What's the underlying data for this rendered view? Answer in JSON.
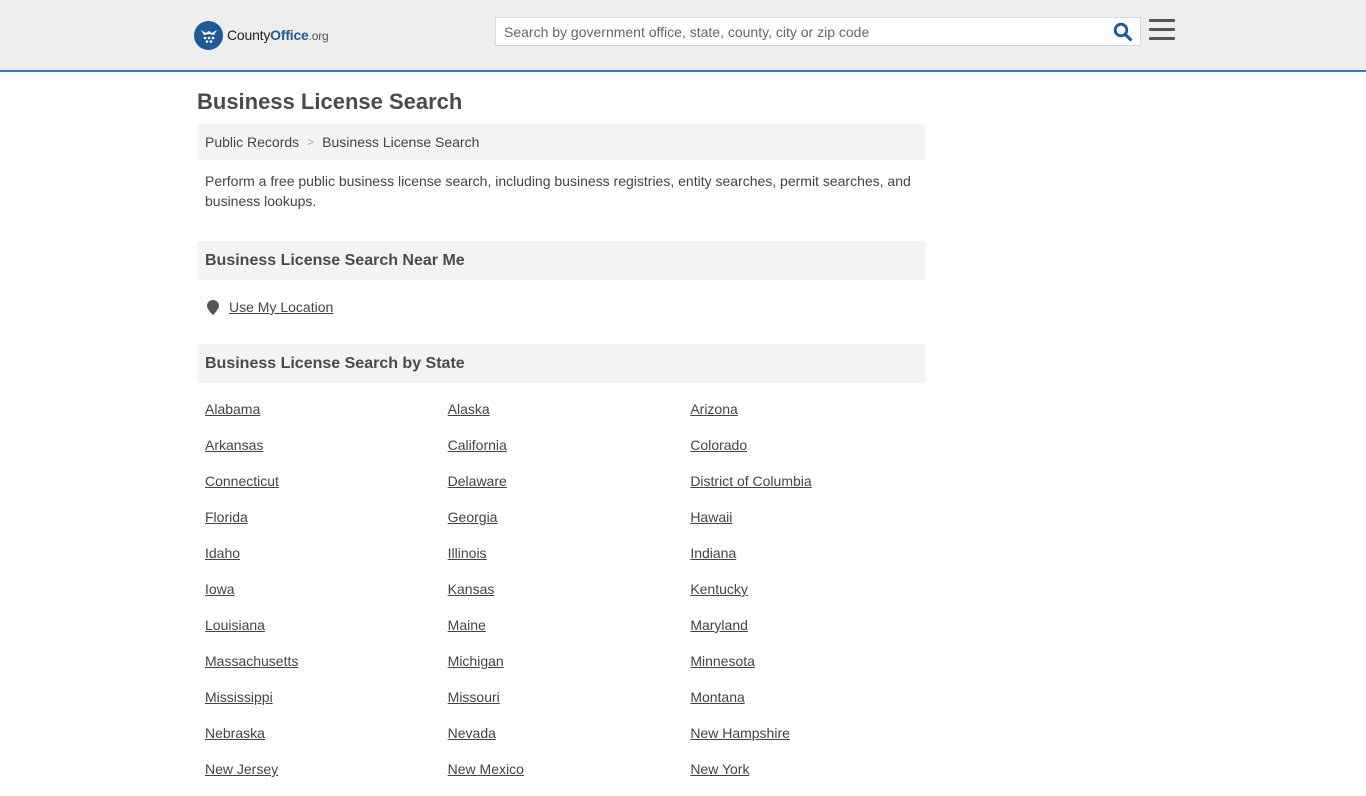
{
  "header": {
    "logo": {
      "name_main": "County",
      "name_accent": "Office",
      "name_suffix": ".org",
      "colors": {
        "brand": "#1f5a96"
      }
    },
    "search": {
      "placeholder": "Search by government office, state, county, city or zip code",
      "value": ""
    },
    "icons": {
      "search": "search-icon",
      "menu": "hamburger-menu-icon"
    }
  },
  "page": {
    "title": "Business License Search",
    "breadcrumb": [
      {
        "label": "Public Records"
      },
      {
        "label": "Business License Search"
      }
    ],
    "breadcrumb_separator": ">",
    "intro": "Perform a free public business license search, including business registries, entity searches, permit searches, and business lookups."
  },
  "near_me": {
    "heading": "Business License Search Near Me",
    "use_location_label": "Use My Location",
    "icon": "map-marker-icon"
  },
  "by_state": {
    "heading": "Business License Search by State",
    "states": [
      "Alabama",
      "Alaska",
      "Arizona",
      "Arkansas",
      "California",
      "Colorado",
      "Connecticut",
      "Delaware",
      "District of Columbia",
      "Florida",
      "Georgia",
      "Hawaii",
      "Idaho",
      "Illinois",
      "Indiana",
      "Iowa",
      "Kansas",
      "Kentucky",
      "Louisiana",
      "Maine",
      "Maryland",
      "Massachusetts",
      "Michigan",
      "Minnesota",
      "Mississippi",
      "Missouri",
      "Montana",
      "Nebraska",
      "Nevada",
      "New Hampshire",
      "New Jersey",
      "New Mexico",
      "New York"
    ]
  }
}
